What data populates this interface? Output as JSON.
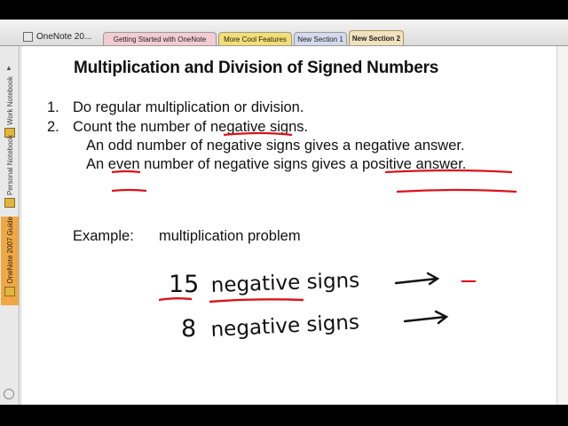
{
  "app": {
    "notebook_label": "OneNote 20...",
    "tabs": [
      "Getting Started with OneNote",
      "More Cool Features",
      "New Section 1",
      "New Section 2"
    ],
    "active_tab": "New Section 2",
    "notebooks": [
      "Work Notebook",
      "Personal Notebook",
      "OneNote 2007 Guide"
    ],
    "colors": {
      "active_tab": "#f1e3bd",
      "active_notebook": "#f0a845",
      "annotation_red": "#d8141c"
    }
  },
  "page": {
    "title": "Multiplication and Division of Signed Numbers",
    "steps": [
      {
        "number": "1.",
        "text": "Do regular multiplication or division."
      },
      {
        "number": "2.",
        "text": "Count the number of negative signs."
      }
    ],
    "rules": [
      {
        "lead": "An",
        "word": "odd",
        "rest": "number of negative signs gives a negative answer."
      },
      {
        "lead": "An",
        "word": "even",
        "rest": "number of negative signs gives a positive answer."
      }
    ],
    "example_label": "Example:",
    "example_text": "multiplication problem"
  },
  "handwriting": {
    "line1_number": "15",
    "line1_words": "negative signs",
    "line1_result": "−",
    "line2_number": "8",
    "line2_words": "negative signs"
  }
}
